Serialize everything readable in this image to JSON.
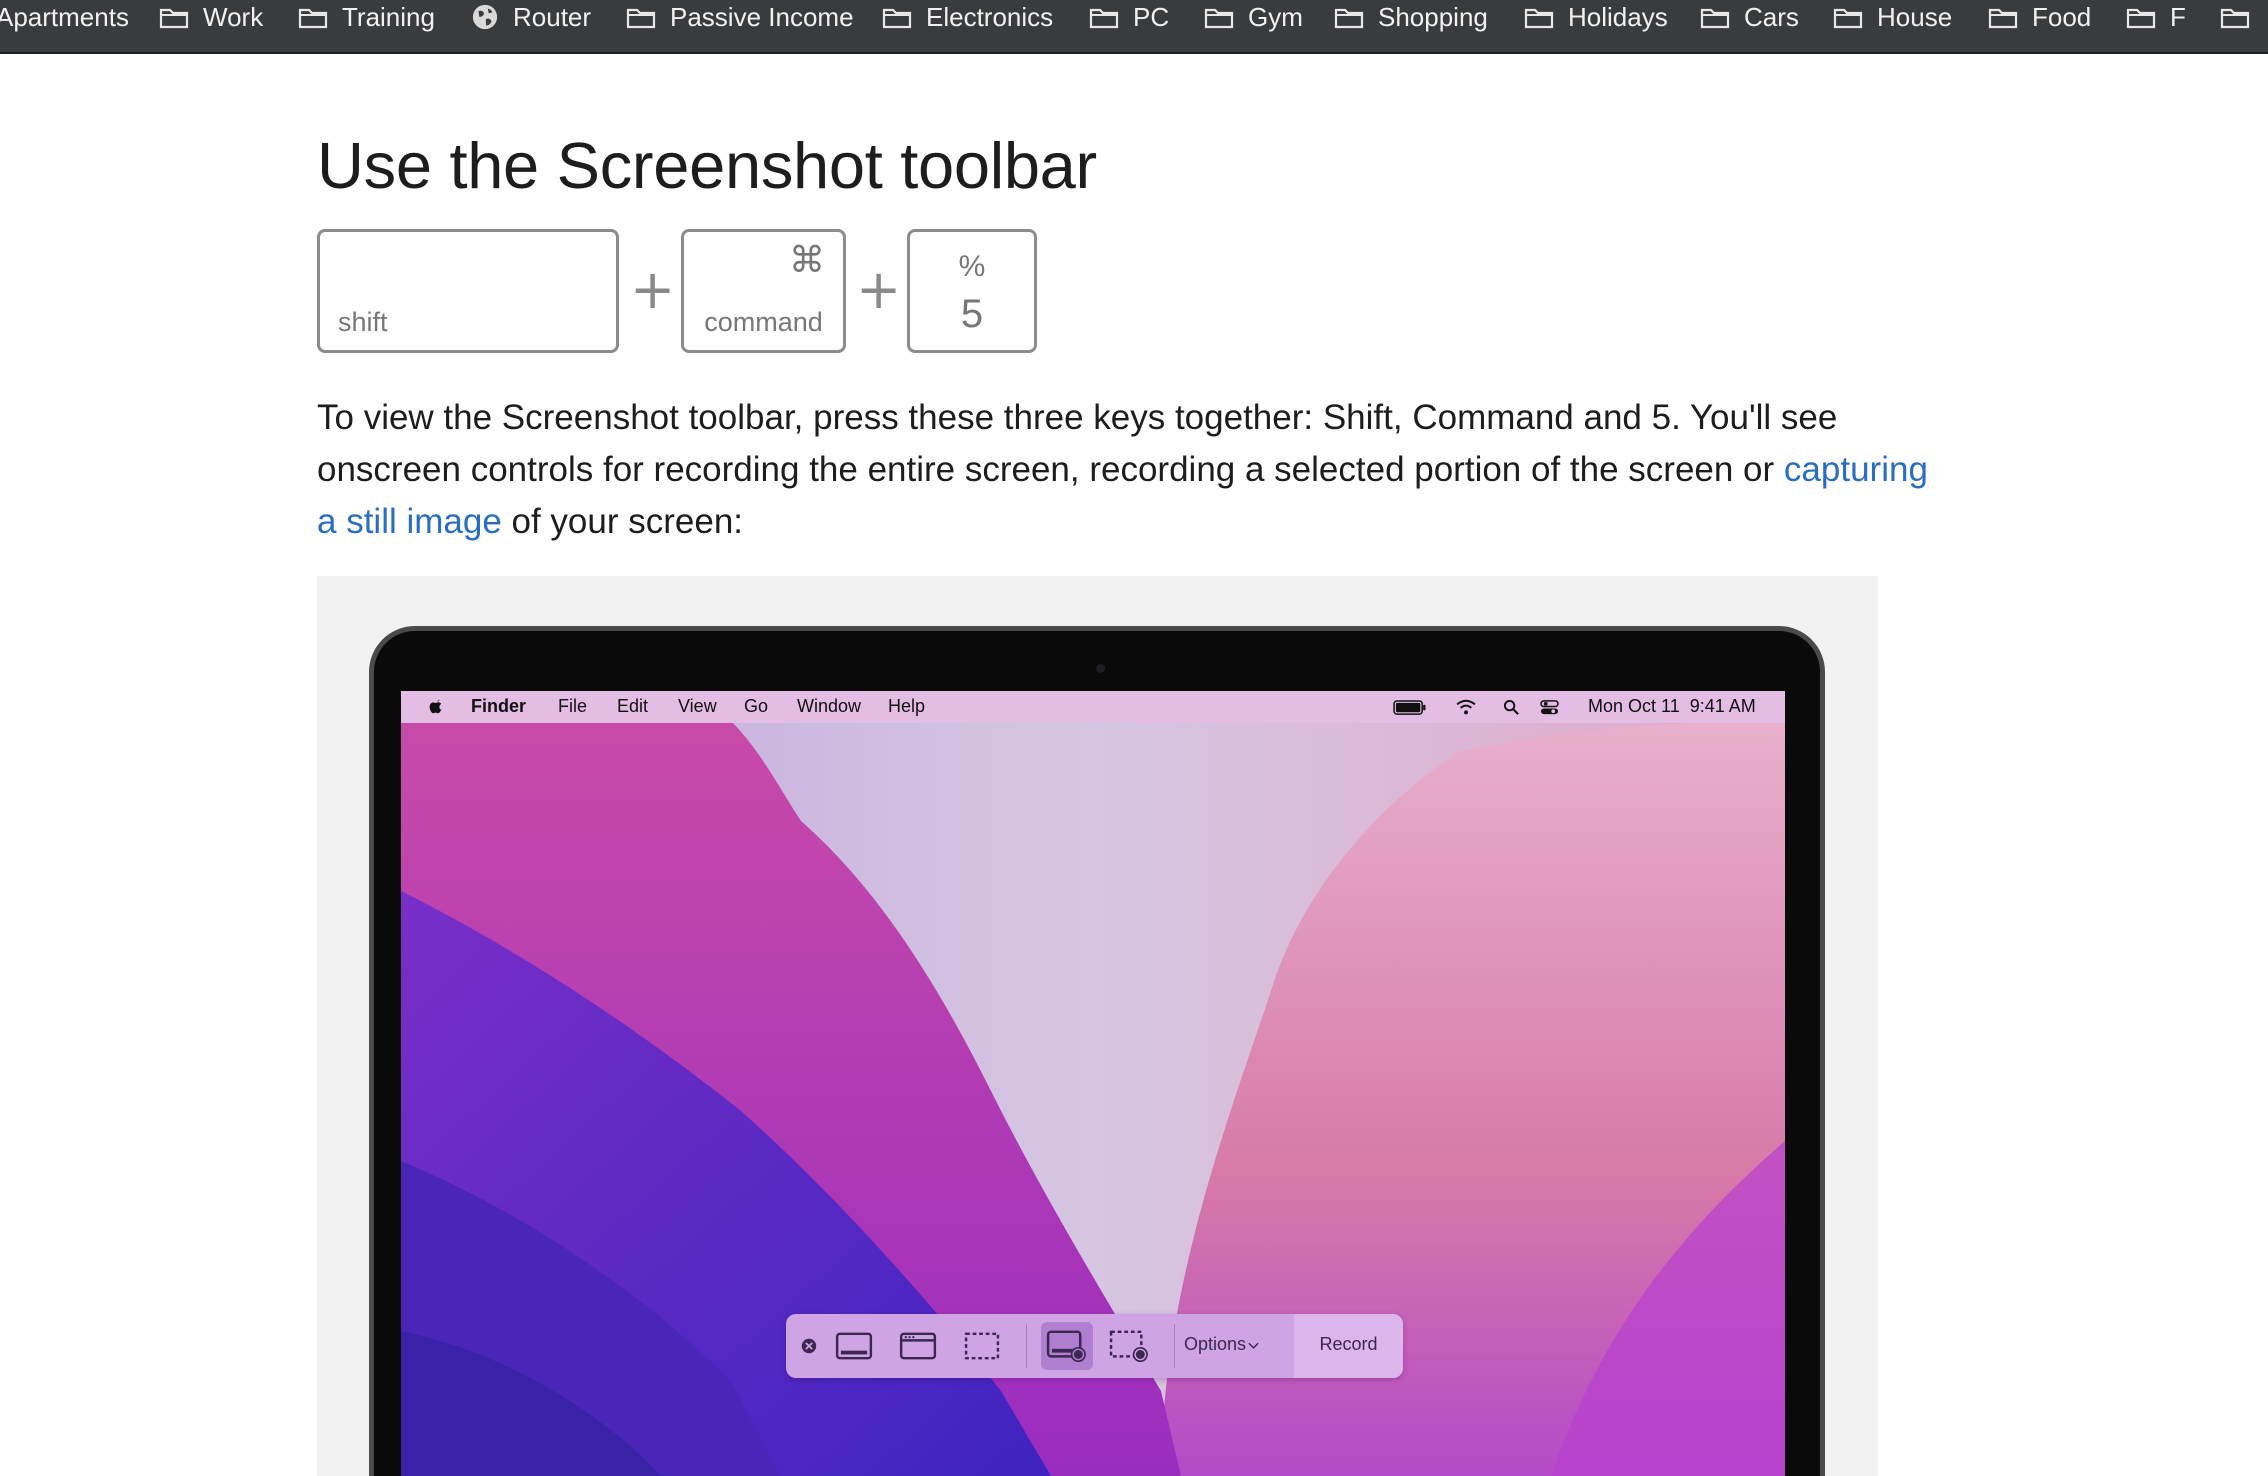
{
  "bookmarks": [
    {
      "label": "Apartments",
      "icon": "folder-icon"
    },
    {
      "label": "Work",
      "icon": "folder-icon"
    },
    {
      "label": "Training",
      "icon": "folder-icon"
    },
    {
      "label": "Router",
      "icon": "globe-icon"
    },
    {
      "label": "Passive Income",
      "icon": "folder-icon"
    },
    {
      "label": "Electronics",
      "icon": "folder-icon"
    },
    {
      "label": "PC",
      "icon": "folder-icon"
    },
    {
      "label": "Gym",
      "icon": "folder-icon"
    },
    {
      "label": "Shopping",
      "icon": "folder-icon"
    },
    {
      "label": "Holidays",
      "icon": "folder-icon"
    },
    {
      "label": "Cars",
      "icon": "folder-icon"
    },
    {
      "label": "House",
      "icon": "folder-icon"
    },
    {
      "label": "Food",
      "icon": "folder-icon"
    },
    {
      "label": "F",
      "icon": "folder-icon"
    }
  ],
  "article": {
    "heading": "Use the Screenshot toolbar",
    "keys": {
      "shift": "shift",
      "command_symbol": "⌘",
      "command": "command",
      "percent": "%",
      "five": "5",
      "plus": "+"
    },
    "paragraph_1": "To view the Screenshot toolbar, press these three keys together: Shift, Command and 5. You'll see onscreen controls for recording the entire screen, recording a selected portion of the screen or ",
    "link_text": "capturing a still image",
    "paragraph_2": " of your screen:"
  },
  "mac_screen": {
    "menu": [
      "Finder",
      "File",
      "Edit",
      "View",
      "Go",
      "Window",
      "Help"
    ],
    "clock": "Mon Oct 11  9:41 AM",
    "toolbar": {
      "options": "Options",
      "record": "Record"
    }
  },
  "colors": {
    "bookmark_bar": "#3a3b3d",
    "link": "#2a6ec2",
    "toolbar": "#cfa4e4",
    "menubar": "#e4bde4"
  }
}
